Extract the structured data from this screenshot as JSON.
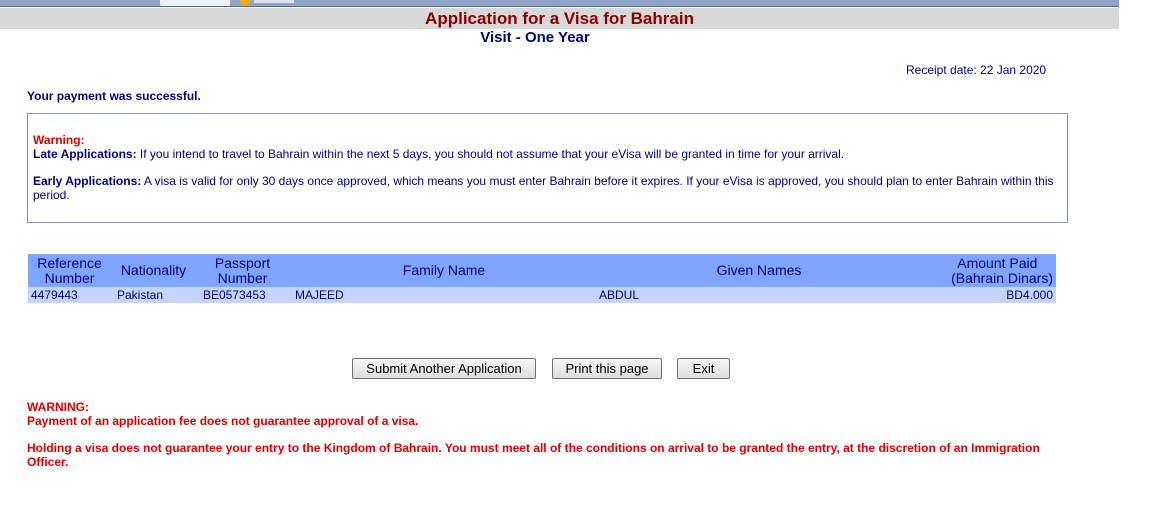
{
  "header": {
    "app_title": "Application for a Visa for Bahrain",
    "subtitle": "Visit - One Year"
  },
  "receipt": {
    "text": "Receipt date: 22 Jan 2020"
  },
  "status": {
    "message": "Your payment was successful."
  },
  "notice": {
    "title": "Warning:",
    "late_label": "Late Applications:",
    "late_text": " If you intend to travel to Bahrain within the next 5 days, you should not assume that your eVisa will be granted in time for your arrival.",
    "early_label": "Early Applications:",
    "early_text": " A visa is valid for only 30 days once approved, which means you must enter Bahrain before it expires. If your eVisa is approved, you should plan to enter Bahrain within this period."
  },
  "table": {
    "headers": {
      "reference_line1": "Reference",
      "reference_line2": "Number",
      "nationality": "Nationality",
      "passport_line1": "Passport",
      "passport_line2": "Number",
      "family_name": "Family Name",
      "given_names": "Given Names",
      "amount_line1": "Amount Paid",
      "amount_line2": "(Bahrain Dinars)"
    },
    "rows": [
      {
        "reference": "4479443",
        "nationality": "Pakistan",
        "passport": "BE0573453",
        "family_name": "MAJEED",
        "given_names": "ABDUL",
        "amount": "BD4.000"
      }
    ]
  },
  "buttons": {
    "submit_another": "Submit Another Application",
    "print": "Print this page",
    "exit": "Exit"
  },
  "bottom_warning": {
    "title": "WARNING:",
    "line1": "Payment of an application fee does not guarantee approval of a visa.",
    "line2": "Holding a visa does not guarantee your entry to the Kingdom of Bahrain. You must meet all of the conditions on arrival to be granted the entry, at the discretion of an Immigration Officer."
  },
  "colors": {
    "title_red": "#8b0000",
    "navy": "#000080",
    "warning_red": "#e00000",
    "table_header_bg": "#7fa5ff",
    "table_row_bg": "#c4d6ff"
  }
}
